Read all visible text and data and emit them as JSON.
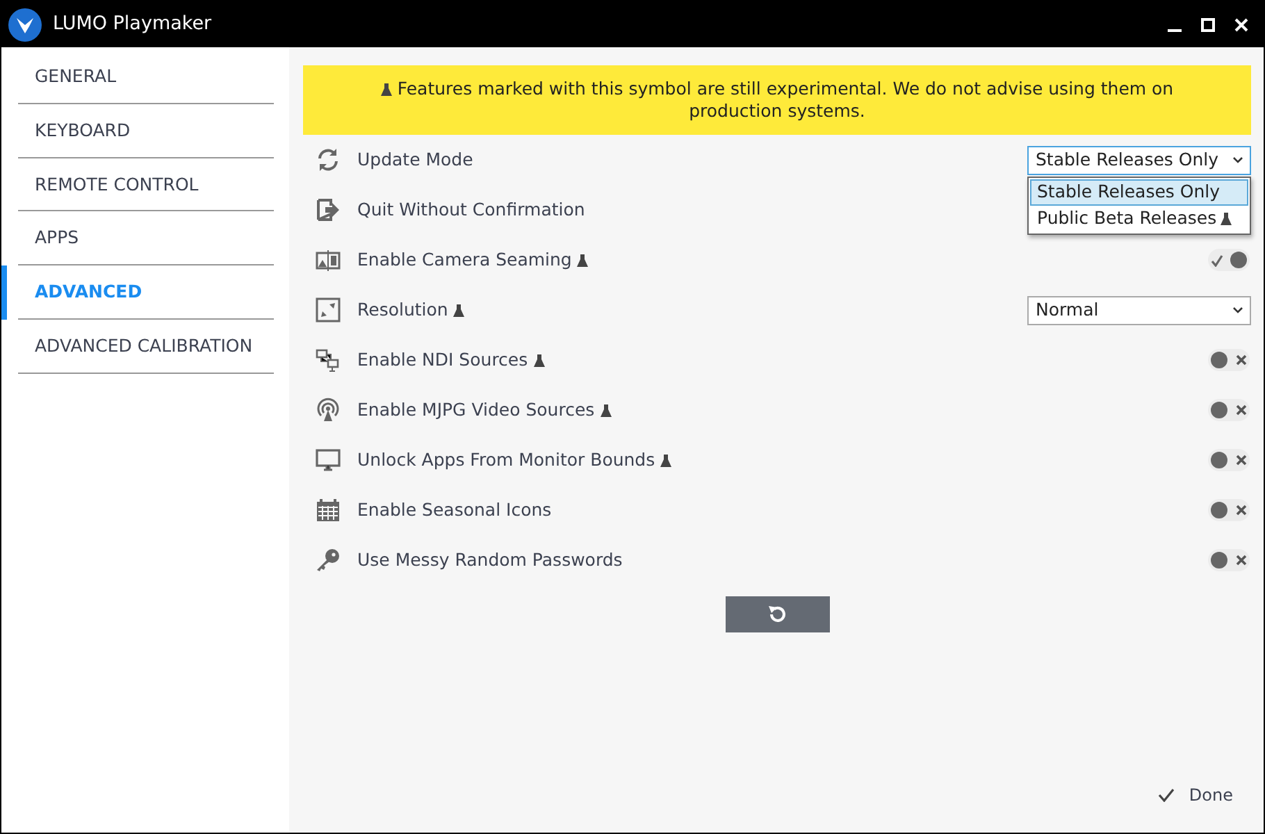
{
  "window": {
    "title": "LUMO Playmaker"
  },
  "sidebar": {
    "items": [
      {
        "label": "GENERAL",
        "selected": false
      },
      {
        "label": "KEYBOARD",
        "selected": false
      },
      {
        "label": "REMOTE CONTROL",
        "selected": false
      },
      {
        "label": "APPS",
        "selected": false
      },
      {
        "label": "ADVANCED",
        "selected": true
      },
      {
        "label": "ADVANCED CALIBRATION",
        "selected": false
      }
    ]
  },
  "banner": {
    "text": "Features marked with this symbol are still experimental. We do not advise using them on production systems."
  },
  "settings": [
    {
      "label": "Update Mode",
      "experimental": false,
      "kind": "select",
      "value": "Stable Releases Only",
      "expanded": true,
      "options": [
        {
          "label": "Stable Releases Only",
          "experimental": false,
          "selected": true
        },
        {
          "label": "Public Beta Releases",
          "experimental": true,
          "selected": false
        }
      ]
    },
    {
      "label": "Quit Without Confirmation",
      "experimental": false,
      "kind": "covered"
    },
    {
      "label": "Enable Camera Seaming",
      "experimental": true,
      "kind": "toggle",
      "on": true
    },
    {
      "label": "Resolution",
      "experimental": true,
      "kind": "select",
      "value": "Normal",
      "expanded": false
    },
    {
      "label": "Enable NDI Sources",
      "experimental": true,
      "kind": "toggle",
      "on": false
    },
    {
      "label": "Enable MJPG Video Sources",
      "experimental": true,
      "kind": "toggle",
      "on": false
    },
    {
      "label": "Unlock Apps From Monitor Bounds",
      "experimental": true,
      "kind": "toggle",
      "on": false
    },
    {
      "label": "Enable Seasonal Icons",
      "experimental": false,
      "kind": "toggle",
      "on": false
    },
    {
      "label": "Use Messy Random Passwords",
      "experimental": false,
      "kind": "toggle",
      "on": false
    }
  ],
  "footer": {
    "done": "Done"
  }
}
